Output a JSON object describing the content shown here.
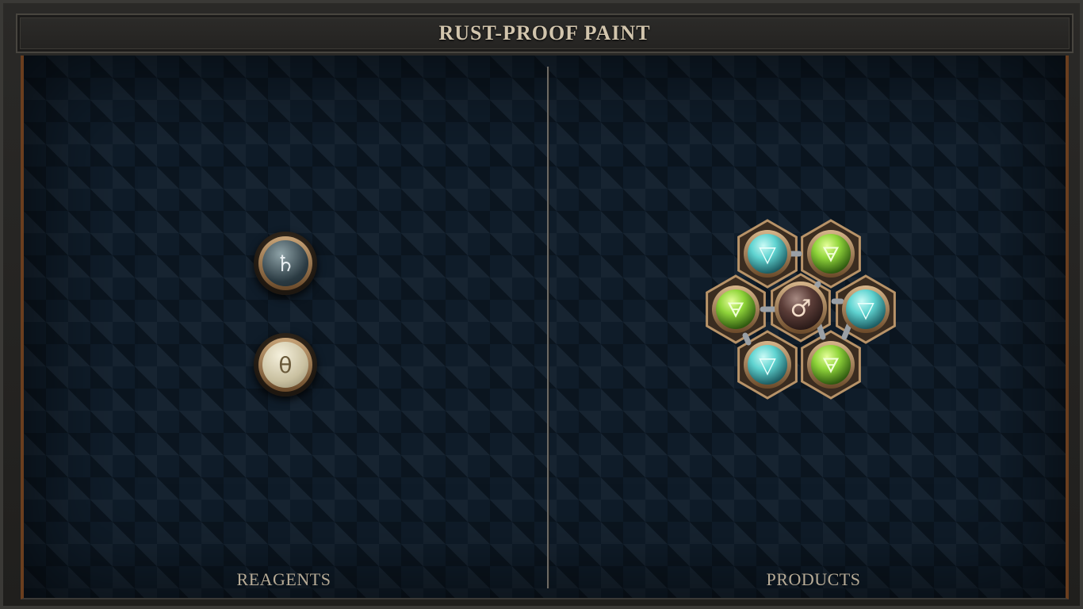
{
  "title": "RUST-PROOF PAINT",
  "reagents_label": "REAGENTS",
  "products_label": "PRODUCTS",
  "reagents": [
    {
      "name": "lead",
      "symbol": "♄",
      "icon": "lead-icon"
    },
    {
      "name": "salt",
      "symbol": "θ",
      "icon": "salt-icon"
    }
  ],
  "product": {
    "center": {
      "name": "iron",
      "symbol": "♂",
      "icon": "iron-icon"
    },
    "atoms": [
      {
        "name": "water",
        "symbol": "▽",
        "icon": "water-icon"
      },
      {
        "name": "earth",
        "symbol": "🜃",
        "icon": "earth-icon"
      },
      {
        "name": "earth",
        "symbol": "🜃",
        "icon": "earth-icon"
      },
      {
        "name": "water",
        "symbol": "▽",
        "icon": "water-icon"
      },
      {
        "name": "water",
        "symbol": "▽",
        "icon": "water-icon"
      },
      {
        "name": "earth",
        "symbol": "🜃",
        "icon": "earth-icon"
      }
    ]
  },
  "colors": {
    "water": "#5fd3d0",
    "earth": "#8fd43a",
    "iron": "#6b4a45",
    "brass": "#b89368"
  }
}
